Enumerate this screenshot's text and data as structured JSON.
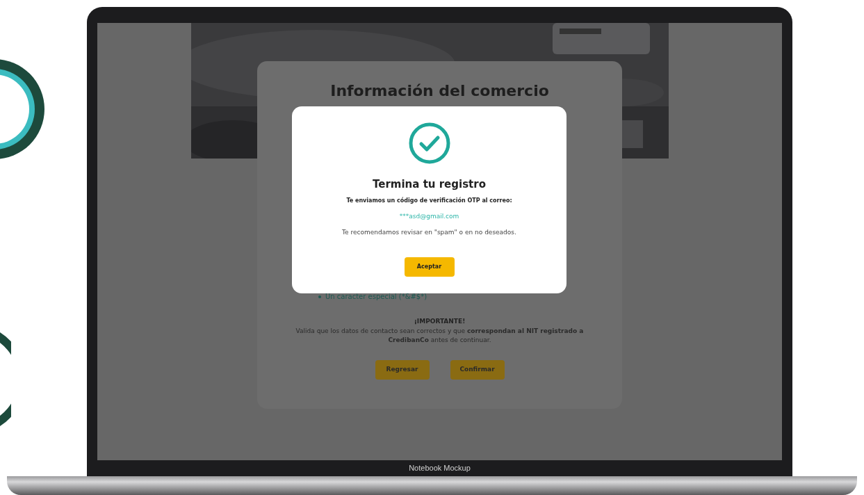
{
  "device": {
    "label": "Notebook Mockup"
  },
  "page": {
    "title": "Información del comercio",
    "hint": "Un caracter especial (*&#$*)",
    "notice_title": "¡IMPORTANTE!",
    "notice_text": "Valida que los datos de contacto sean correctos y que **correspondan al NIT registrado a CredibanCo** antes de continuar.",
    "buttons": [
      {
        "label": "Regresar"
      },
      {
        "label": "Confirmar"
      }
    ]
  },
  "dialog": {
    "title": "Termina tu registro",
    "message": "Te enviamos un código de verificación OTP al correo:",
    "email": "***asd@gmail.com",
    "note": "Te recomendamos revisar en \"spam\" o en no deseados.",
    "button": "Aceptar"
  }
}
